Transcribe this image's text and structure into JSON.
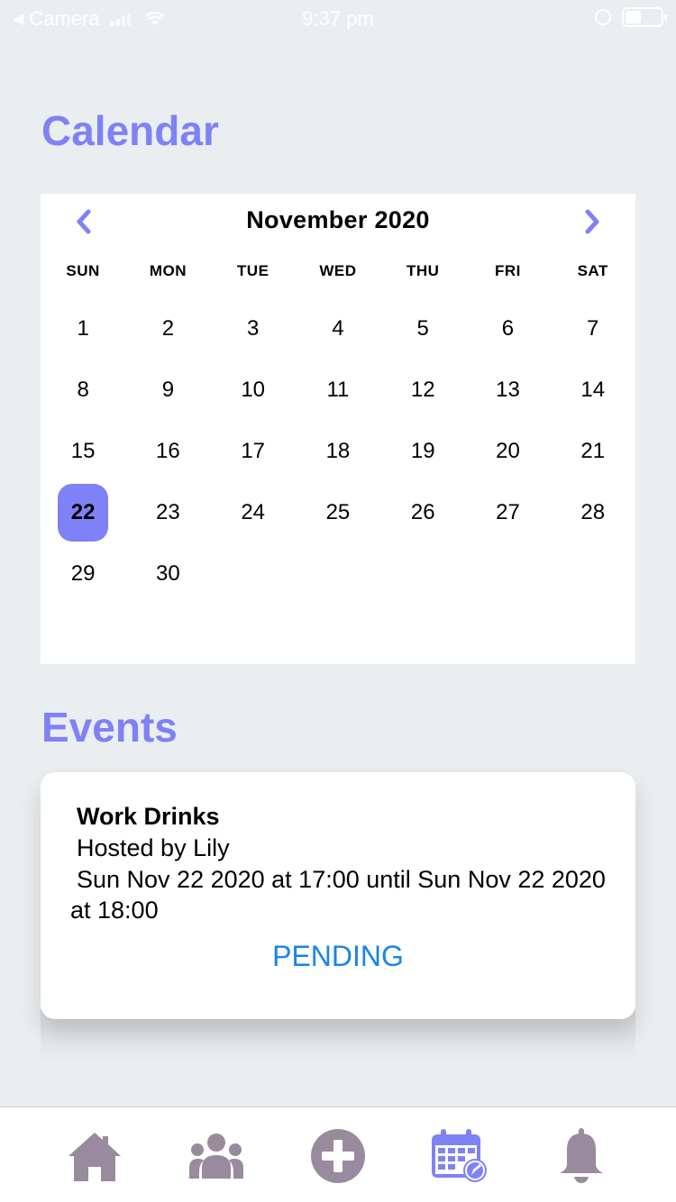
{
  "status_bar": {
    "back_app": "Camera",
    "time": "9:37 pm",
    "battery_level": 0.45
  },
  "calendar_section": {
    "title": "Calendar",
    "month_label": "November 2020",
    "weekdays": [
      "SUN",
      "MON",
      "TUE",
      "WED",
      "THU",
      "FRI",
      "SAT"
    ],
    "weeks": [
      [
        "1",
        "2",
        "3",
        "4",
        "5",
        "6",
        "7"
      ],
      [
        "8",
        "9",
        "10",
        "11",
        "12",
        "13",
        "14"
      ],
      [
        "15",
        "16",
        "17",
        "18",
        "19",
        "20",
        "21"
      ],
      [
        "22",
        "23",
        "24",
        "25",
        "26",
        "27",
        "28"
      ],
      [
        "29",
        "30",
        "",
        "",
        "",
        "",
        ""
      ]
    ],
    "selected_day": "22",
    "accent_color": "#7f81f7"
  },
  "events_section": {
    "title": "Events",
    "events": [
      {
        "name": "Work Drinks",
        "host": "Hosted by Lily",
        "time": "Sun Nov 22 2020 at 17:00 until Sun Nov 22 2020 at 18:00",
        "status": "PENDING",
        "status_color": "#1a84e8"
      }
    ]
  },
  "tab_bar": {
    "icon_color": "#9a8a9e",
    "active_color": "#7f81f7",
    "tabs": [
      {
        "icon": "home-icon",
        "active": false
      },
      {
        "icon": "friends-icon",
        "active": false
      },
      {
        "icon": "add-circle-icon",
        "active": false
      },
      {
        "icon": "calendar-icon",
        "active": true
      },
      {
        "icon": "bell-icon",
        "active": false
      }
    ]
  }
}
